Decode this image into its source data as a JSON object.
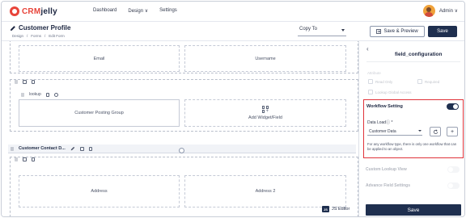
{
  "brand": {
    "crm": "CRM",
    "rest": "jelly",
    "accent": "#e8443a"
  },
  "nav": {
    "items": [
      "Dashboard",
      "Design ∨",
      "Settings"
    ]
  },
  "user": {
    "name": "Admin ∨"
  },
  "header": {
    "title": "Customer Profile",
    "breadcrumb": [
      "Design",
      "/",
      "Forms",
      "/",
      "Edit Form"
    ],
    "copy_to": "Copy To",
    "preview_label": "Save & Preview",
    "save_label": "Save"
  },
  "canvas": {
    "row1": [
      "Email",
      "Username"
    ],
    "lookup_label": "lookup",
    "row2_left": "Customer Posting Group",
    "add_widget_label": "Add Widget/Field",
    "contact_section": "Customer Contact D...",
    "row3": [
      "Address",
      "Address 2"
    ],
    "js_editor": "JS Editor"
  },
  "panel": {
    "title": "field_configuration",
    "attribute_label": "Attribute",
    "read_only": "Read Only",
    "required": "Required",
    "lookup_global_access": "Lookup Global Access",
    "workflow": {
      "title": "Workflow Setting",
      "enabled": true,
      "data_load_label": "Data Loadⓘ *",
      "data_load_value": "Customer Data",
      "help_text": "For any workflow type, there is only one workflow that can be applied to an object."
    },
    "custom_lookup_view": "Custom Lookup View",
    "advance_field_settings": "Advance Field Settings",
    "save_label": "Save"
  },
  "colors": {
    "primary": "#1f2f4f",
    "highlight": "#e0333a"
  }
}
